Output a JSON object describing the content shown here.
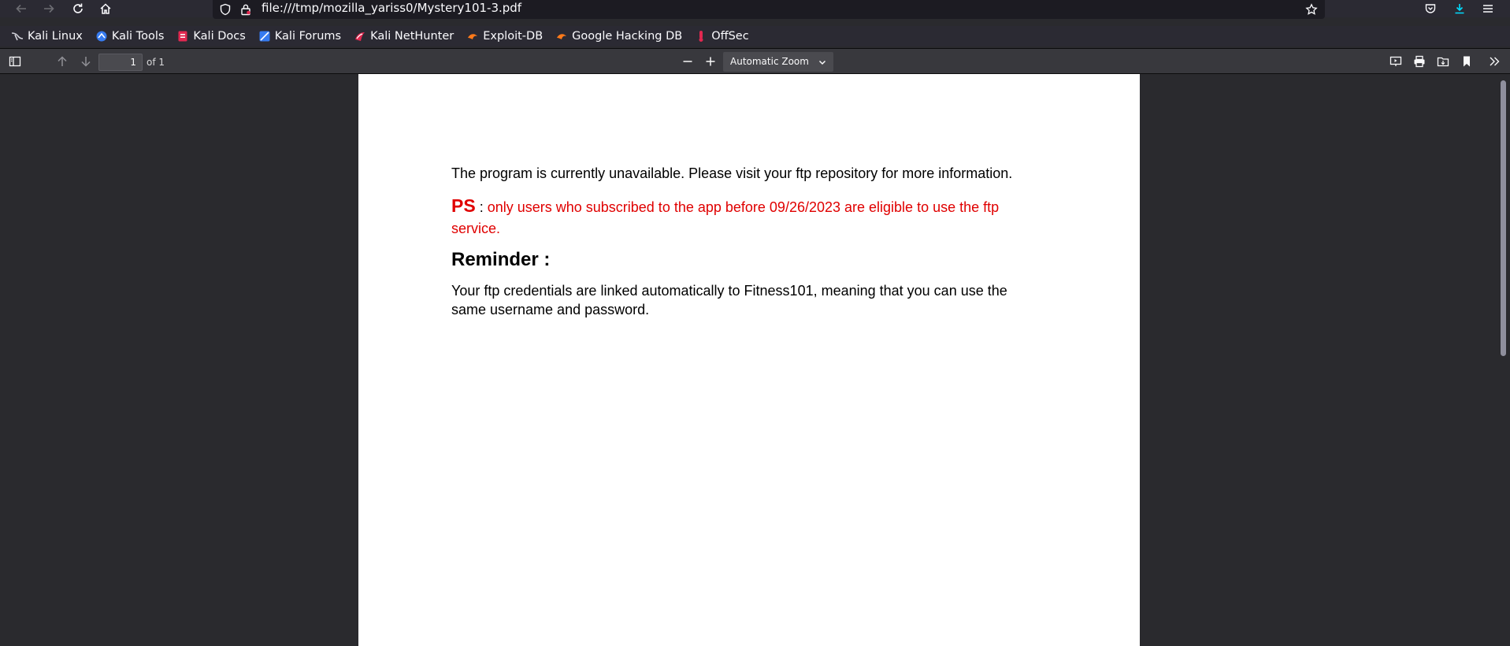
{
  "browser": {
    "url": "file:///tmp/mozilla_yariss0/Mystery101-3.pdf"
  },
  "bookmarks": [
    {
      "label": "Kali Linux",
      "icon": "kali-dragon-icon"
    },
    {
      "label": "Kali Tools",
      "icon": "kali-tools-icon"
    },
    {
      "label": "Kali Docs",
      "icon": "kali-docs-icon"
    },
    {
      "label": "Kali Forums",
      "icon": "kali-forums-icon"
    },
    {
      "label": "Kali NetHunter",
      "icon": "nethunter-icon"
    },
    {
      "label": "Exploit-DB",
      "icon": "exploit-db-icon"
    },
    {
      "label": "Google Hacking DB",
      "icon": "ghdb-icon"
    },
    {
      "label": "OffSec",
      "icon": "offsec-icon"
    }
  ],
  "pdf_toolbar": {
    "page_number": "1",
    "page_count_label": "of 1",
    "zoom": "Automatic Zoom"
  },
  "document": {
    "line1": "The program is currently unavailable. Please visit your ftp repository for more information.",
    "ps_label": "PS",
    "ps_colon": " :",
    "ps_text_line1": " only users who subscribed to the app before 09/26/2023 are eligible to use the ftp",
    "ps_text_line2": "service.",
    "reminder_heading": "Reminder :",
    "body_line1": "Your ftp credentials are linked automatically to Fitness101, meaning that you can use the",
    "body_line2": "same username and password."
  },
  "colors": {
    "accent_red": "#e00000",
    "toolbar_bg": "#2b2a33",
    "download_blue": "#0df"
  }
}
